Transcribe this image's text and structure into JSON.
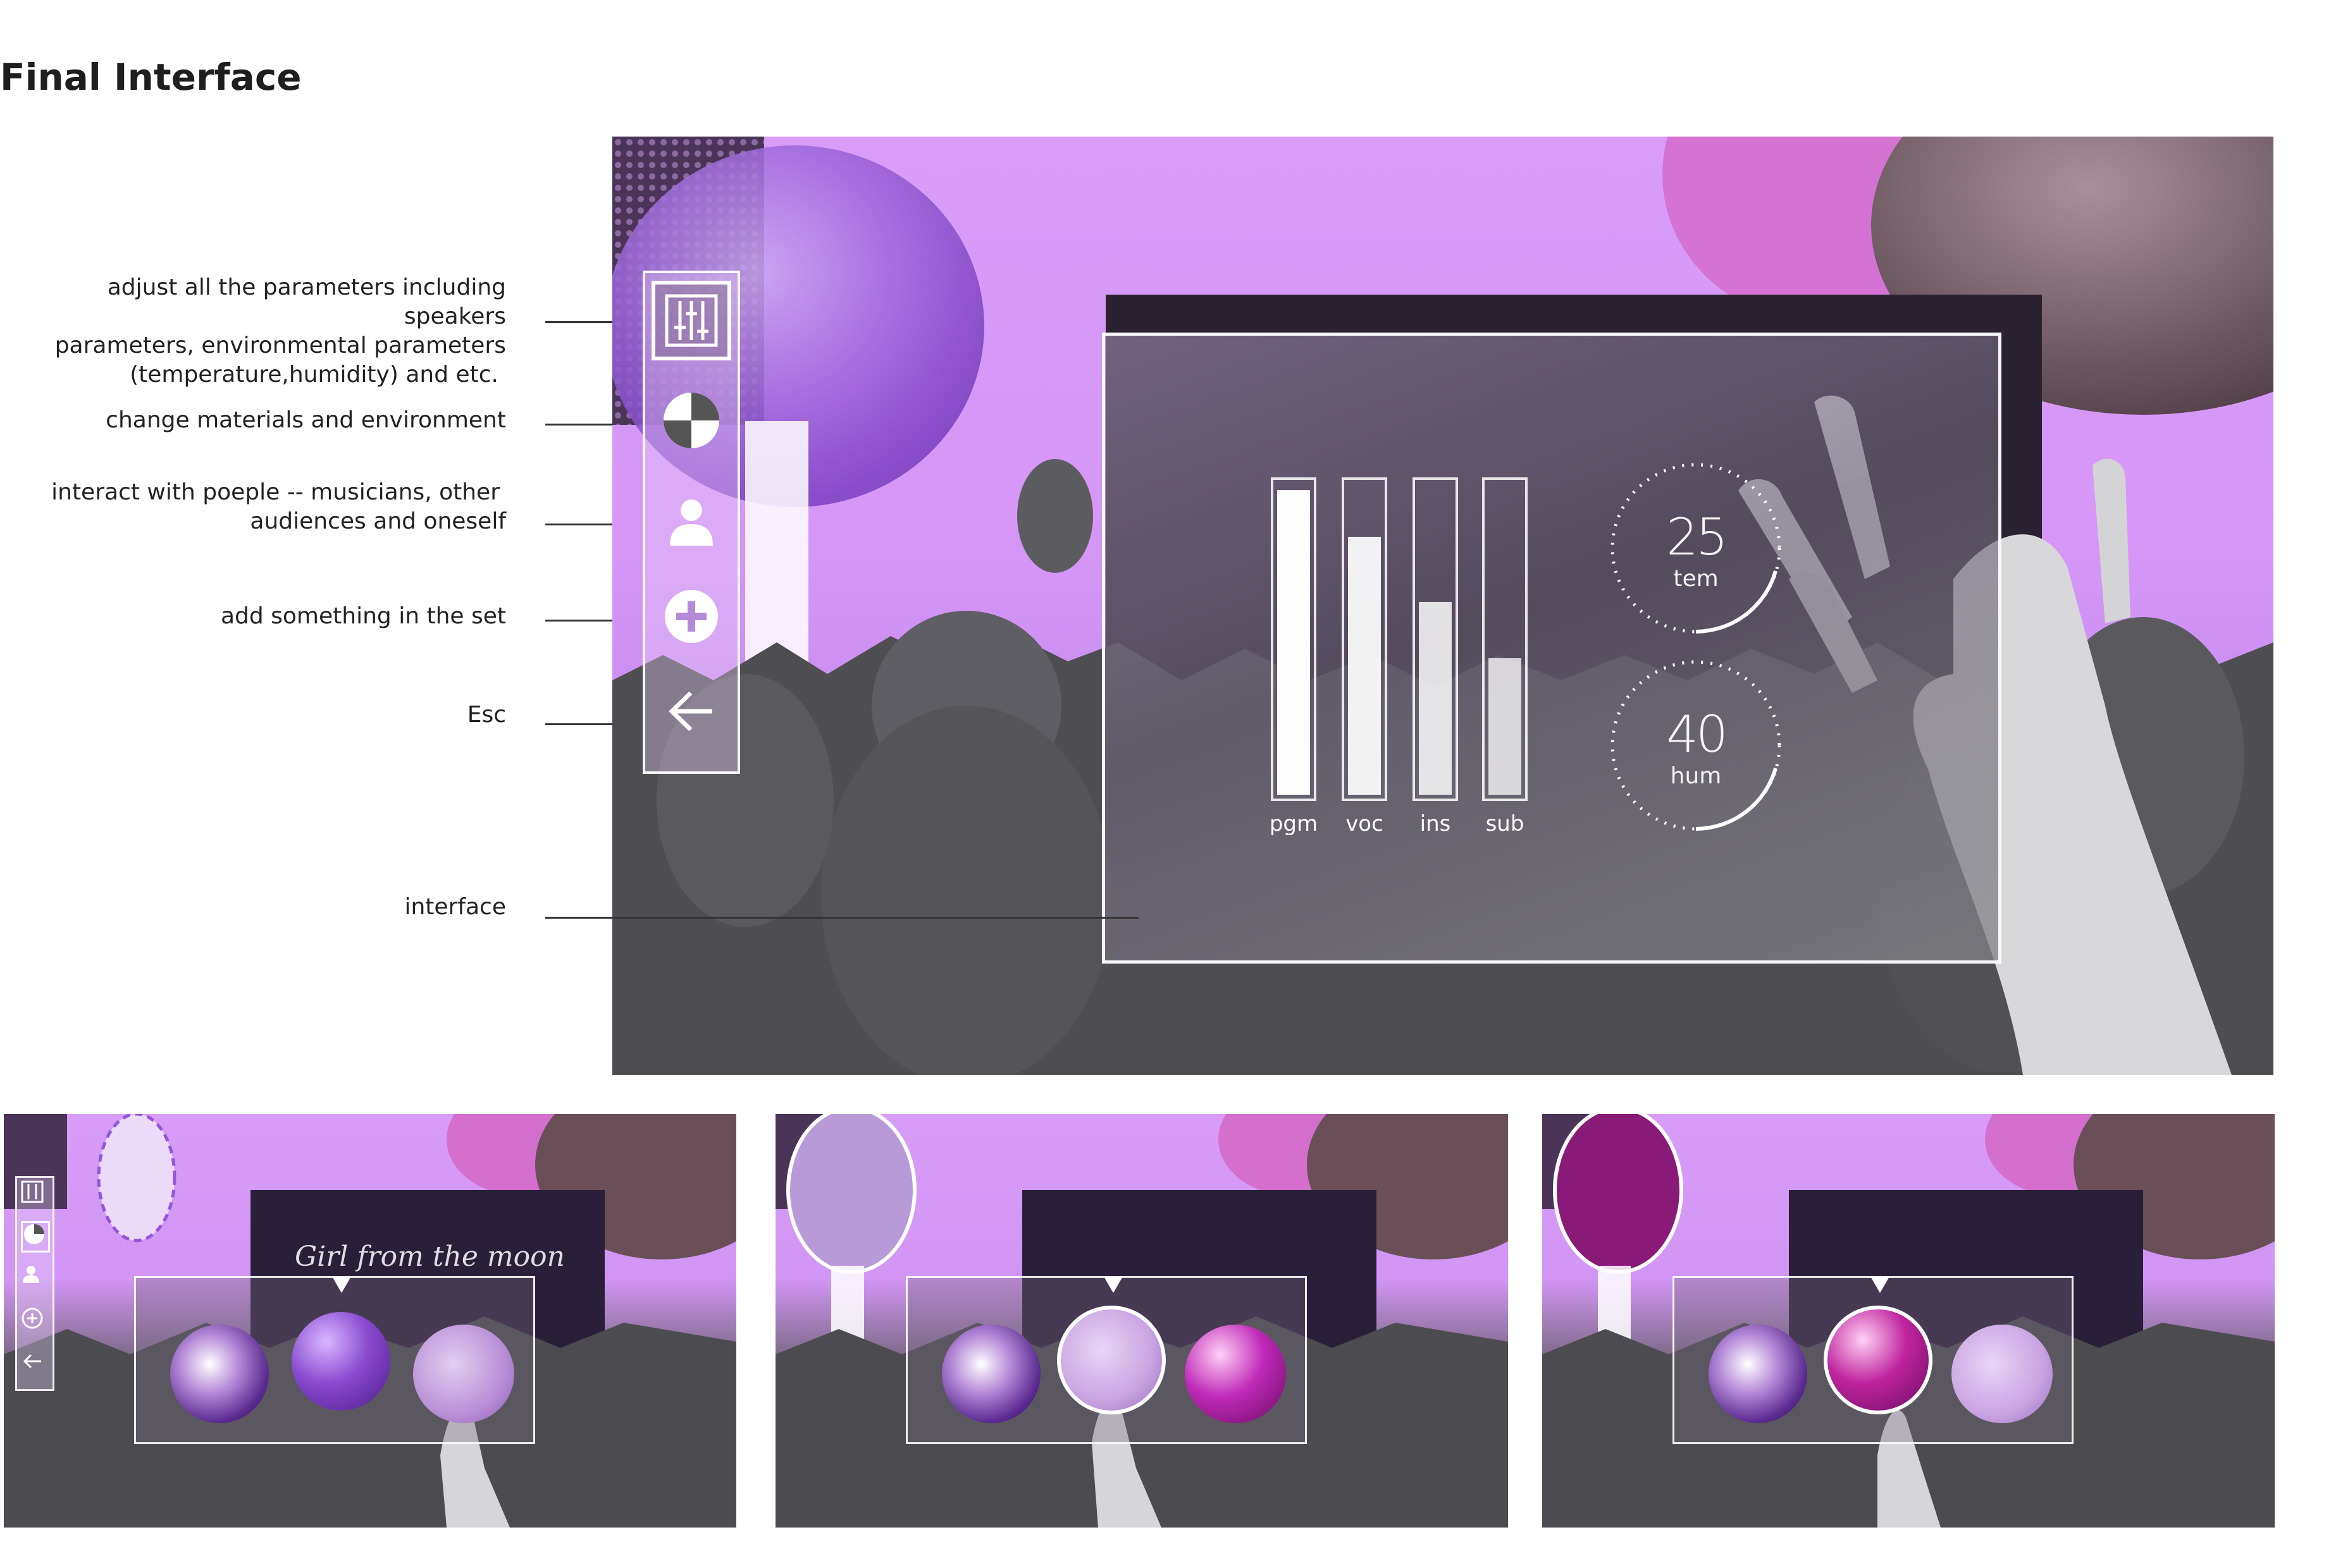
{
  "page": {
    "title": "Final Interface"
  },
  "annotations": [
    {
      "id": "adjust",
      "lines": [
        "adjust all the parameters including speakers",
        "parameters, environmental parameters",
        "(temperature,humidity) and etc."
      ]
    },
    {
      "id": "materials",
      "lines": [
        "change materials and environment"
      ]
    },
    {
      "id": "people",
      "lines": [
        "interact with poeple -- musicians, other",
        "audiences and oneself"
      ]
    },
    {
      "id": "add",
      "lines": [
        "add something in the set"
      ]
    },
    {
      "id": "esc",
      "lines": [
        "Esc"
      ]
    },
    {
      "id": "interface",
      "lines": [
        "interface"
      ]
    }
  ],
  "side_menu": {
    "items": [
      {
        "name": "parameters-button",
        "icon": "sliders-icon",
        "active": true
      },
      {
        "name": "materials-button",
        "icon": "pie-material-icon",
        "active": false
      },
      {
        "name": "people-button",
        "icon": "person-icon",
        "active": false
      },
      {
        "name": "add-button",
        "icon": "plus-circle-icon",
        "active": false
      },
      {
        "name": "esc-button",
        "icon": "arrow-left-icon",
        "active": false
      }
    ]
  },
  "panel": {
    "bars": [
      {
        "label": "pgm",
        "level": 0.98
      },
      {
        "label": "voc",
        "level": 0.83
      },
      {
        "label": "ins",
        "level": 0.62
      },
      {
        "label": "sub",
        "level": 0.44
      }
    ],
    "gauges": [
      {
        "value": "25",
        "unit": "tem"
      },
      {
        "value": "40",
        "unit": "hum"
      }
    ]
  },
  "thumbnails": [
    {
      "name": "thumb-step-1",
      "selected_index": 2,
      "sphere_colors": [
        "#6a3aa0",
        "#8a4ad0",
        "#b98fd8"
      ],
      "screen_text": "Girl from the moon"
    },
    {
      "name": "thumb-step-2",
      "selected_index": 1,
      "sphere_colors": [
        "#6a3aa0",
        "#c8a3e0",
        "#c02ab8"
      ],
      "screen_text": ""
    },
    {
      "name": "thumb-step-3",
      "selected_index": 1,
      "sphere_colors": [
        "#6a3aa0",
        "#c0249e",
        "#c9a3e2"
      ],
      "screen_text": ""
    }
  ],
  "colors": {
    "sky": "#d99cf8",
    "crowd": "#4f4f53",
    "accent": "#ffffff"
  }
}
